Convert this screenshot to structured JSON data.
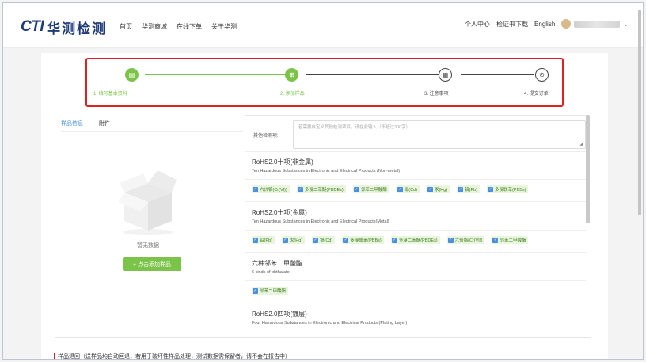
{
  "header": {
    "logo_en": "CTI",
    "logo_cn": "华测检测",
    "nav": [
      "首页",
      "华测商城",
      "在线下单",
      "关于华测"
    ],
    "user_links": [
      "个人中心",
      "检证书下载",
      "English"
    ]
  },
  "stepper": {
    "steps": [
      {
        "label": "1. 填写基本资料",
        "status": "done",
        "icon": "form-icon"
      },
      {
        "label": "2. 添加样品",
        "status": "done",
        "icon": "sample-icon"
      },
      {
        "label": "3. 注意事项",
        "status": "todo",
        "icon": "document-icon"
      },
      {
        "label": "4. 提交订单",
        "status": "todo",
        "icon": "submit-icon"
      }
    ],
    "accent": "#7cc34a",
    "highlight": "#e02020"
  },
  "left_panel": {
    "tabs": [
      "样品信息",
      "附件"
    ],
    "empty_text": "暂无数据",
    "add_button": "+ 点击添加样品"
  },
  "right_panel": {
    "other_label": "其他检测项:",
    "other_placeholder": "若需要自定义其他检测项目，请在此输入（不超过300字）",
    "sections": [
      {
        "title": "RoHS2.0十项(非金属)",
        "subtitle": "Ten Hazardous Substances in Electronic and Electrical Products (Non-metal)",
        "tags": [
          "六价铬(Cr(VI))",
          "多溴二苯醚(PBDEs)",
          "邻苯二甲酸酯",
          "镉(Cd)",
          "汞(Hg)",
          "铅(Pb)",
          "多溴联苯(PBBs)"
        ]
      },
      {
        "title": "RoHS2.0十项(金属)",
        "subtitle": "Ten Hazardous Substances in Electronic and Electrical Products(Metal)",
        "tags": [
          "铅(Pb)",
          "汞(Hg)",
          "镉(Cd)",
          "多溴联苯(PBBs)",
          "多溴二苯醚(PBDEs)",
          "六价铬(Cr(VI))",
          "邻苯二甲酸酯"
        ]
      },
      {
        "title": "六种邻苯二甲酸酯",
        "subtitle": "6 kinds of phthalate",
        "tags": [
          "邻苯二甲酸酯"
        ]
      },
      {
        "title": "RoHS2.0四项(镀层)",
        "subtitle": "Four Hazardous Substances in Electronic and Electrical Products (Plating Layer)",
        "tags": []
      }
    ]
  },
  "bottom": {
    "text": "样品退回（送样品均自动回退，若用于破坏性样品处理，测试数据需保留者，请不会在报告中）"
  }
}
